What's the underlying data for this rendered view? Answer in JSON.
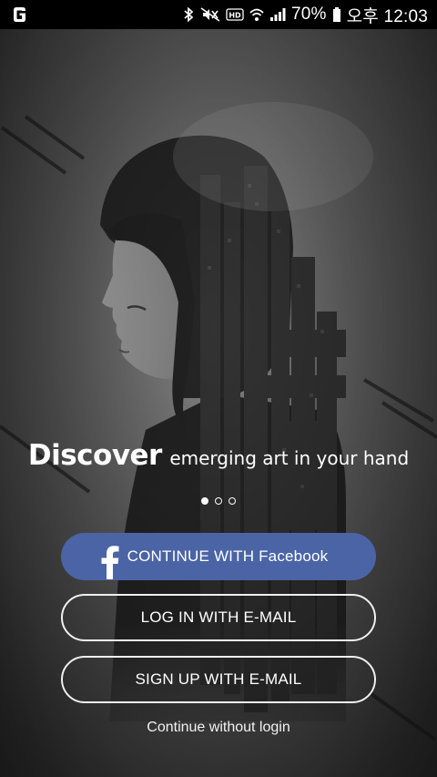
{
  "status_bar": {
    "battery_pct": "70%",
    "time": "오후 12:03",
    "icons": [
      "app-logo-icon",
      "bluetooth-icon",
      "mute-icon",
      "hd-icon",
      "wifi-icon",
      "signal-icon",
      "battery-icon"
    ],
    "hd_label": "HD"
  },
  "hero": {
    "headline_strong": "Discover",
    "headline_rest": "emerging art in your hand"
  },
  "pager": {
    "pages": 3,
    "active": 0
  },
  "buttons": {
    "facebook": "CONTINUE WITH Facebook",
    "login": "LOG IN WITH E-MAIL",
    "signup": "SIGN UP WITH E-MAIL"
  },
  "skip_link": "Continue without login",
  "colors": {
    "facebook_blue": "#4a64a6",
    "status_bar_bg": "#000000",
    "text": "#ffffff"
  }
}
